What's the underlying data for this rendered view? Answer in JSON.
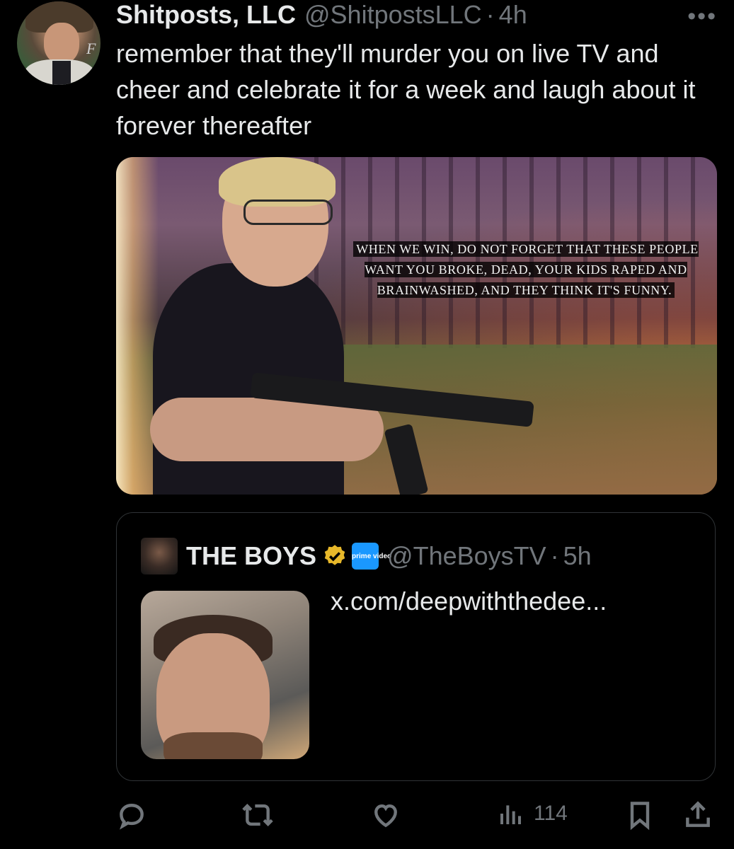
{
  "tweet": {
    "display_name": "Shitposts, LLC",
    "handle": "@ShitpostsLLC",
    "separator": "·",
    "time": "4h",
    "more_label": "•••",
    "text": "remember that they'll murder you on live TV and cheer and celebrate it for a week and laugh about it forever thereafter",
    "avatar_mark": "F",
    "media_caption": "When we win, do not forget that these people want you broke, dead, your kids raped and brainwashed, and they think it's funny."
  },
  "quote": {
    "display_name": "THE BOYS",
    "badge_text": "prime video",
    "handle": "@TheBoysTV",
    "separator": "·",
    "time": "5h",
    "link_text": "x.com/deepwiththedee..."
  },
  "actions": {
    "views_count": "114"
  },
  "colors": {
    "background": "#000000",
    "text": "#e7e9ea",
    "muted": "#71767b",
    "border": "#2f3336",
    "verified_gold": "#e8b82a",
    "prime_blue": "#1a98ff"
  },
  "icons": [
    "reply-icon",
    "repost-icon",
    "like-icon",
    "views-icon",
    "bookmark-icon",
    "share-icon",
    "verified-badge-icon",
    "more-icon"
  ]
}
